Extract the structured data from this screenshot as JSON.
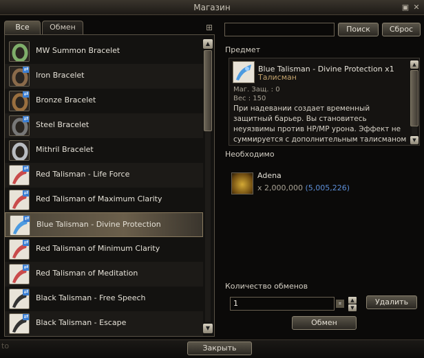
{
  "window": {
    "title": "Магазин",
    "pin_icon": "pin-icon",
    "close_icon": "close-icon"
  },
  "tabs": [
    {
      "label": "Все",
      "active": true
    },
    {
      "label": "Обмен",
      "active": false
    }
  ],
  "list": {
    "items": [
      {
        "name": "MW Summon Bracelet",
        "icon": "bracelet-icon",
        "color": "#7fae6a",
        "badge": false,
        "selected": false
      },
      {
        "name": "Iron Bracelet",
        "icon": "bracelet-icon",
        "color": "#8a6a4a",
        "badge": true,
        "selected": false
      },
      {
        "name": "Bronze Bracelet",
        "icon": "bracelet-icon",
        "color": "#9a6f3f",
        "badge": true,
        "selected": false
      },
      {
        "name": "Steel Bracelet",
        "icon": "bracelet-icon",
        "color": "#777777",
        "badge": true,
        "selected": false
      },
      {
        "name": "Mithril Bracelet",
        "icon": "bracelet-icon",
        "color": "#b9bcc1",
        "badge": false,
        "selected": false
      },
      {
        "name": "Red Talisman - Life Force",
        "icon": "talisman-icon",
        "color": "#c94b4b",
        "badge": true,
        "selected": false
      },
      {
        "name": "Red Talisman of Maximum Clarity",
        "icon": "talisman-icon",
        "color": "#c94b4b",
        "badge": true,
        "selected": false
      },
      {
        "name": "Blue Talisman - Divine Protection",
        "icon": "talisman-icon",
        "color": "#4d9be0",
        "badge": true,
        "selected": true
      },
      {
        "name": "Red Talisman of Minimum Clarity",
        "icon": "talisman-icon",
        "color": "#c94b4b",
        "badge": true,
        "selected": false
      },
      {
        "name": "Red Talisman of Meditation",
        "icon": "talisman-icon",
        "color": "#c94b4b",
        "badge": true,
        "selected": false
      },
      {
        "name": "Black Talisman - Free Speech",
        "icon": "talisman-icon",
        "color": "#333333",
        "badge": true,
        "selected": false
      },
      {
        "name": "Black Talisman - Escape",
        "icon": "talisman-icon",
        "color": "#333333",
        "badge": true,
        "selected": false
      }
    ]
  },
  "search": {
    "value": "",
    "search_label": "Поиск",
    "reset_label": "Сброс"
  },
  "detail": {
    "section_label": "Предмет",
    "name": "Blue Talisman - Divine Protection x1",
    "category": "Талисман",
    "stat1": "Маг. Защ. : 0",
    "stat2": "Вес : 150",
    "description": "При надевании создает временный защитный барьер. Вы становитесь неуязвимы против HP/MP урона. Эффект не суммируется с дополнительным талисманом такого же типа.",
    "icon_color": "#4d9be0"
  },
  "required": {
    "section_label": "Необходимо",
    "name": "Adena",
    "amount": "x 2,000,000",
    "owned": "(5,005,226)"
  },
  "exchange": {
    "section_label": "Количество обменов",
    "quantity": "1",
    "delete_label": "Удалить",
    "exchange_label": "Обмен"
  },
  "footer": {
    "close_label": "Закрыть",
    "corner_text": "to"
  }
}
